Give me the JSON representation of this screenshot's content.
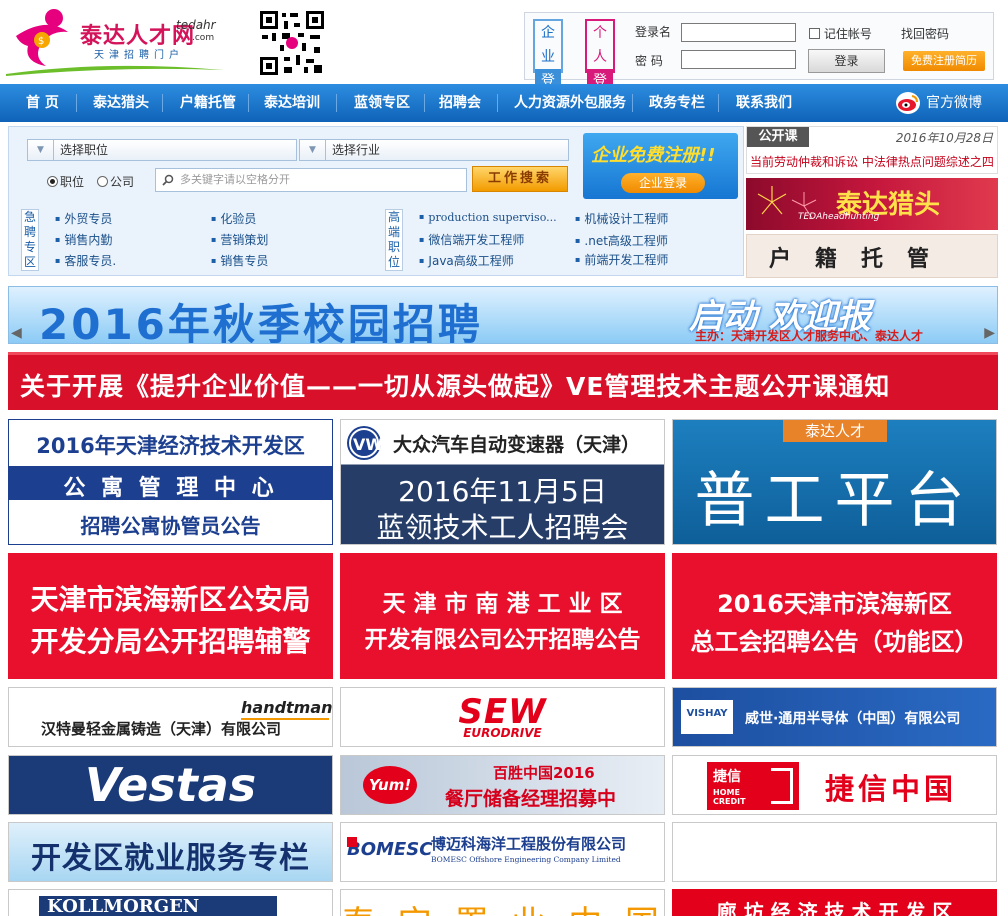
{
  "header": {
    "logo_brand": "泰达人才网",
    "logo_domain": "tedahr",
    "logo_domain_suffix": ".com",
    "logo_tagline": "天津招聘门户"
  },
  "login": {
    "company_top": "企业",
    "company_bottom": "登录",
    "person_top": "个人",
    "person_bottom": "登录",
    "username_label": "登录名",
    "password_label": "密 码",
    "remember_label": "记住帐号",
    "forgot_label": "找回密码",
    "login_button": "登录",
    "register_button": "免费注册简历"
  },
  "nav": {
    "items": [
      "首 页",
      "泰达猎头",
      "户籍托管",
      "泰达培训",
      "蓝领专区",
      "招聘会",
      "人力资源外包服务",
      "政务专栏",
      "联系我们"
    ],
    "weibo": "官方微博"
  },
  "search": {
    "position_select": "选择职位",
    "industry_select": "选择行业",
    "radio_job": "职位",
    "radio_company": "公司",
    "keyword_placeholder": "多关键字请以空格分开",
    "search_button": "工作搜索",
    "urgent_label": "急聘专区",
    "senior_label": "高端职位",
    "urgent_jobs": [
      "外贸专员",
      "化验员",
      "销售内勤",
      "营销策划",
      "客服专员.",
      "销售专员"
    ],
    "senior_jobs": [
      "production superviso...",
      "机械设计工程师",
      "微信端开发工程师",
      ".net高级工程师",
      "Java高级工程师",
      "前端开发工程师"
    ],
    "reg_ad_title": "企业免费注册!!",
    "reg_ad_button": "企业登录"
  },
  "sidebar": {
    "course_tag": "公开课",
    "course_date": "2016年10月28日",
    "course_title": "当前劳动仲裁和诉讼 中法律热点问题综述之四",
    "headhunt_title": "泰达猎头",
    "headhunt_sub": "TEDAheadhunting",
    "huji_title": "户籍托管"
  },
  "banners": {
    "campus_title": "2016年秋季校园招聘",
    "campus_title2": "启动 欢迎报名！！！",
    "campus_sub": "主办：天津开发区人才服务中心、泰达人才",
    "ve_title": "关于开展《提升企业价值——一切从源头做起》VE管理技术主题公开课通知"
  },
  "tiles": {
    "apartment": [
      "2016年天津经济技术开发区",
      "公 寓 管 理 中 心",
      "招聘公寓协管员公告"
    ],
    "vw": [
      "大众汽车自动变速器（天津）",
      "2016年11月5日",
      "蓝领技术工人招聘会"
    ],
    "worker": [
      "泰达人才",
      "普工平台"
    ],
    "police": [
      "天津市滨海新区公安局",
      "开发分局公开招聘辅警"
    ],
    "nangang": [
      "天 津 市 南 港 工 业 区",
      "开发有限公司公开招聘公告"
    ],
    "union": [
      "2016天津市滨海新区",
      "总工会招聘公告（功能区）"
    ],
    "handtmann": [
      "handtmann",
      "汉特曼轻金属铸造（天津）有限公司"
    ],
    "sew": [
      "SEW",
      "EURODRIVE"
    ],
    "vishay": [
      "VISHAY",
      "威世·通用半导体（中国）有限公司"
    ],
    "vestas": [
      "Vestas"
    ],
    "yum": [
      "Yum!",
      "百胜中国2016",
      "餐厅储备经理招募中"
    ],
    "homecredit": [
      "捷信",
      "HOME CREDIT",
      "捷信中国"
    ],
    "devzone": [
      "开发区就业服务专栏"
    ],
    "bomesc": [
      "BOMESC",
      "博迈科海洋工程股份有限公司",
      "BOMESC Offshore Engineering Company Limited"
    ],
    "kollmorgen": [
      "KOLLMORGEN"
    ],
    "bottom_mid": [
      "泰 宝 置 业 中 国"
    ],
    "langfang": [
      "廊 坊 经 济 技 术 开 发 区"
    ]
  }
}
